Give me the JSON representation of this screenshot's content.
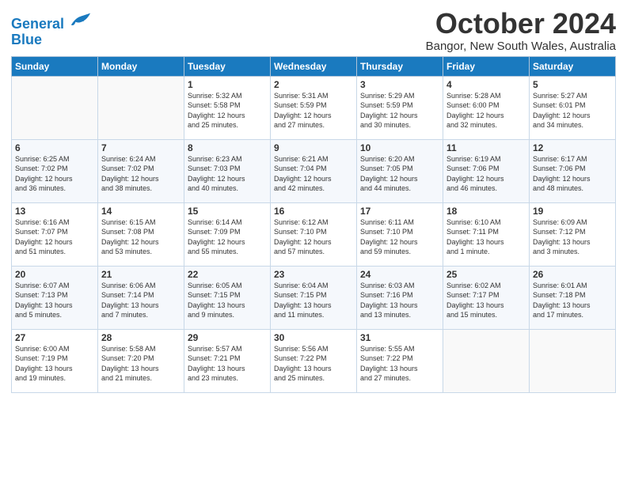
{
  "logo": {
    "line1": "General",
    "line2": "Blue"
  },
  "title": "October 2024",
  "subtitle": "Bangor, New South Wales, Australia",
  "days_of_week": [
    "Sunday",
    "Monday",
    "Tuesday",
    "Wednesday",
    "Thursday",
    "Friday",
    "Saturday"
  ],
  "weeks": [
    [
      {
        "day": "",
        "info": ""
      },
      {
        "day": "",
        "info": ""
      },
      {
        "day": "1",
        "info": "Sunrise: 5:32 AM\nSunset: 5:58 PM\nDaylight: 12 hours\nand 25 minutes."
      },
      {
        "day": "2",
        "info": "Sunrise: 5:31 AM\nSunset: 5:59 PM\nDaylight: 12 hours\nand 27 minutes."
      },
      {
        "day": "3",
        "info": "Sunrise: 5:29 AM\nSunset: 5:59 PM\nDaylight: 12 hours\nand 30 minutes."
      },
      {
        "day": "4",
        "info": "Sunrise: 5:28 AM\nSunset: 6:00 PM\nDaylight: 12 hours\nand 32 minutes."
      },
      {
        "day": "5",
        "info": "Sunrise: 5:27 AM\nSunset: 6:01 PM\nDaylight: 12 hours\nand 34 minutes."
      }
    ],
    [
      {
        "day": "6",
        "info": "Sunrise: 6:25 AM\nSunset: 7:02 PM\nDaylight: 12 hours\nand 36 minutes."
      },
      {
        "day": "7",
        "info": "Sunrise: 6:24 AM\nSunset: 7:02 PM\nDaylight: 12 hours\nand 38 minutes."
      },
      {
        "day": "8",
        "info": "Sunrise: 6:23 AM\nSunset: 7:03 PM\nDaylight: 12 hours\nand 40 minutes."
      },
      {
        "day": "9",
        "info": "Sunrise: 6:21 AM\nSunset: 7:04 PM\nDaylight: 12 hours\nand 42 minutes."
      },
      {
        "day": "10",
        "info": "Sunrise: 6:20 AM\nSunset: 7:05 PM\nDaylight: 12 hours\nand 44 minutes."
      },
      {
        "day": "11",
        "info": "Sunrise: 6:19 AM\nSunset: 7:06 PM\nDaylight: 12 hours\nand 46 minutes."
      },
      {
        "day": "12",
        "info": "Sunrise: 6:17 AM\nSunset: 7:06 PM\nDaylight: 12 hours\nand 48 minutes."
      }
    ],
    [
      {
        "day": "13",
        "info": "Sunrise: 6:16 AM\nSunset: 7:07 PM\nDaylight: 12 hours\nand 51 minutes."
      },
      {
        "day": "14",
        "info": "Sunrise: 6:15 AM\nSunset: 7:08 PM\nDaylight: 12 hours\nand 53 minutes."
      },
      {
        "day": "15",
        "info": "Sunrise: 6:14 AM\nSunset: 7:09 PM\nDaylight: 12 hours\nand 55 minutes."
      },
      {
        "day": "16",
        "info": "Sunrise: 6:12 AM\nSunset: 7:10 PM\nDaylight: 12 hours\nand 57 minutes."
      },
      {
        "day": "17",
        "info": "Sunrise: 6:11 AM\nSunset: 7:10 PM\nDaylight: 12 hours\nand 59 minutes."
      },
      {
        "day": "18",
        "info": "Sunrise: 6:10 AM\nSunset: 7:11 PM\nDaylight: 13 hours\nand 1 minute."
      },
      {
        "day": "19",
        "info": "Sunrise: 6:09 AM\nSunset: 7:12 PM\nDaylight: 13 hours\nand 3 minutes."
      }
    ],
    [
      {
        "day": "20",
        "info": "Sunrise: 6:07 AM\nSunset: 7:13 PM\nDaylight: 13 hours\nand 5 minutes."
      },
      {
        "day": "21",
        "info": "Sunrise: 6:06 AM\nSunset: 7:14 PM\nDaylight: 13 hours\nand 7 minutes."
      },
      {
        "day": "22",
        "info": "Sunrise: 6:05 AM\nSunset: 7:15 PM\nDaylight: 13 hours\nand 9 minutes."
      },
      {
        "day": "23",
        "info": "Sunrise: 6:04 AM\nSunset: 7:15 PM\nDaylight: 13 hours\nand 11 minutes."
      },
      {
        "day": "24",
        "info": "Sunrise: 6:03 AM\nSunset: 7:16 PM\nDaylight: 13 hours\nand 13 minutes."
      },
      {
        "day": "25",
        "info": "Sunrise: 6:02 AM\nSunset: 7:17 PM\nDaylight: 13 hours\nand 15 minutes."
      },
      {
        "day": "26",
        "info": "Sunrise: 6:01 AM\nSunset: 7:18 PM\nDaylight: 13 hours\nand 17 minutes."
      }
    ],
    [
      {
        "day": "27",
        "info": "Sunrise: 6:00 AM\nSunset: 7:19 PM\nDaylight: 13 hours\nand 19 minutes."
      },
      {
        "day": "28",
        "info": "Sunrise: 5:58 AM\nSunset: 7:20 PM\nDaylight: 13 hours\nand 21 minutes."
      },
      {
        "day": "29",
        "info": "Sunrise: 5:57 AM\nSunset: 7:21 PM\nDaylight: 13 hours\nand 23 minutes."
      },
      {
        "day": "30",
        "info": "Sunrise: 5:56 AM\nSunset: 7:22 PM\nDaylight: 13 hours\nand 25 minutes."
      },
      {
        "day": "31",
        "info": "Sunrise: 5:55 AM\nSunset: 7:22 PM\nDaylight: 13 hours\nand 27 minutes."
      },
      {
        "day": "",
        "info": ""
      },
      {
        "day": "",
        "info": ""
      }
    ]
  ]
}
